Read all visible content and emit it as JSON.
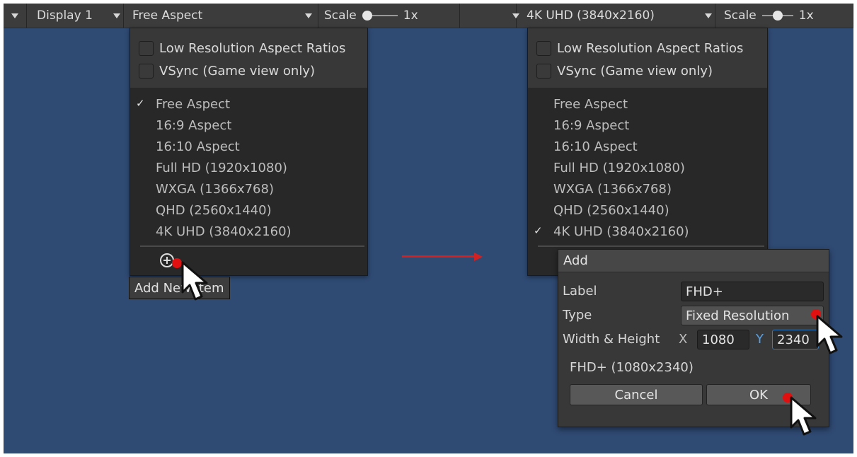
{
  "toolbar_left": {
    "display_label": "Display 1",
    "aspect_label": "Free Aspect",
    "scale_label": "Scale",
    "scale_value": "1x"
  },
  "toolbar_right": {
    "aspect_label": "4K UHD (3840x2160)",
    "scale_label": "Scale",
    "scale_value": "1x"
  },
  "menu_left": {
    "options": [
      "Low Resolution Aspect Ratios",
      "VSync (Game view only)"
    ],
    "items": [
      "Free Aspect",
      "16:9 Aspect",
      "16:10 Aspect",
      "Full HD (1920x1080)",
      "WXGA (1366x768)",
      "QHD (2560x1440)",
      "4K UHD (3840x2160)"
    ],
    "selected": "Free Aspect",
    "add_tooltip": "Add New Item"
  },
  "menu_right": {
    "options": [
      "Low Resolution Aspect Ratios",
      "VSync (Game view only)"
    ],
    "items": [
      "Free Aspect",
      "16:9 Aspect",
      "16:10 Aspect",
      "Full HD (1920x1080)",
      "WXGA (1366x768)",
      "QHD (2560x1440)",
      "4K UHD (3840x2160)"
    ],
    "selected": "4K UHD (3840x2160)"
  },
  "add_dialog": {
    "title": "Add",
    "label_caption": "Label",
    "label_value": "FHD+",
    "type_caption": "Type",
    "type_value": "Fixed Resolution",
    "size_caption": "Width & Height",
    "x_label": "X",
    "width_value": "1080",
    "y_label": "Y",
    "height_value": "2340",
    "preview": "FHD+ (1080x2340)",
    "cancel_label": "Cancel",
    "ok_label": "OK"
  },
  "icons": {
    "dropdown": "triangle-down-icon",
    "add": "plus-circle-icon",
    "cursor": "mouse-pointer-icon",
    "check": "checkmark-icon"
  },
  "colors": {
    "background": "#2f4a73",
    "toolbar": "#3c3c3c",
    "menu": "#282828",
    "arrow": "#d42020",
    "click_dot": "#e01010",
    "focus": "#3a79bb"
  }
}
